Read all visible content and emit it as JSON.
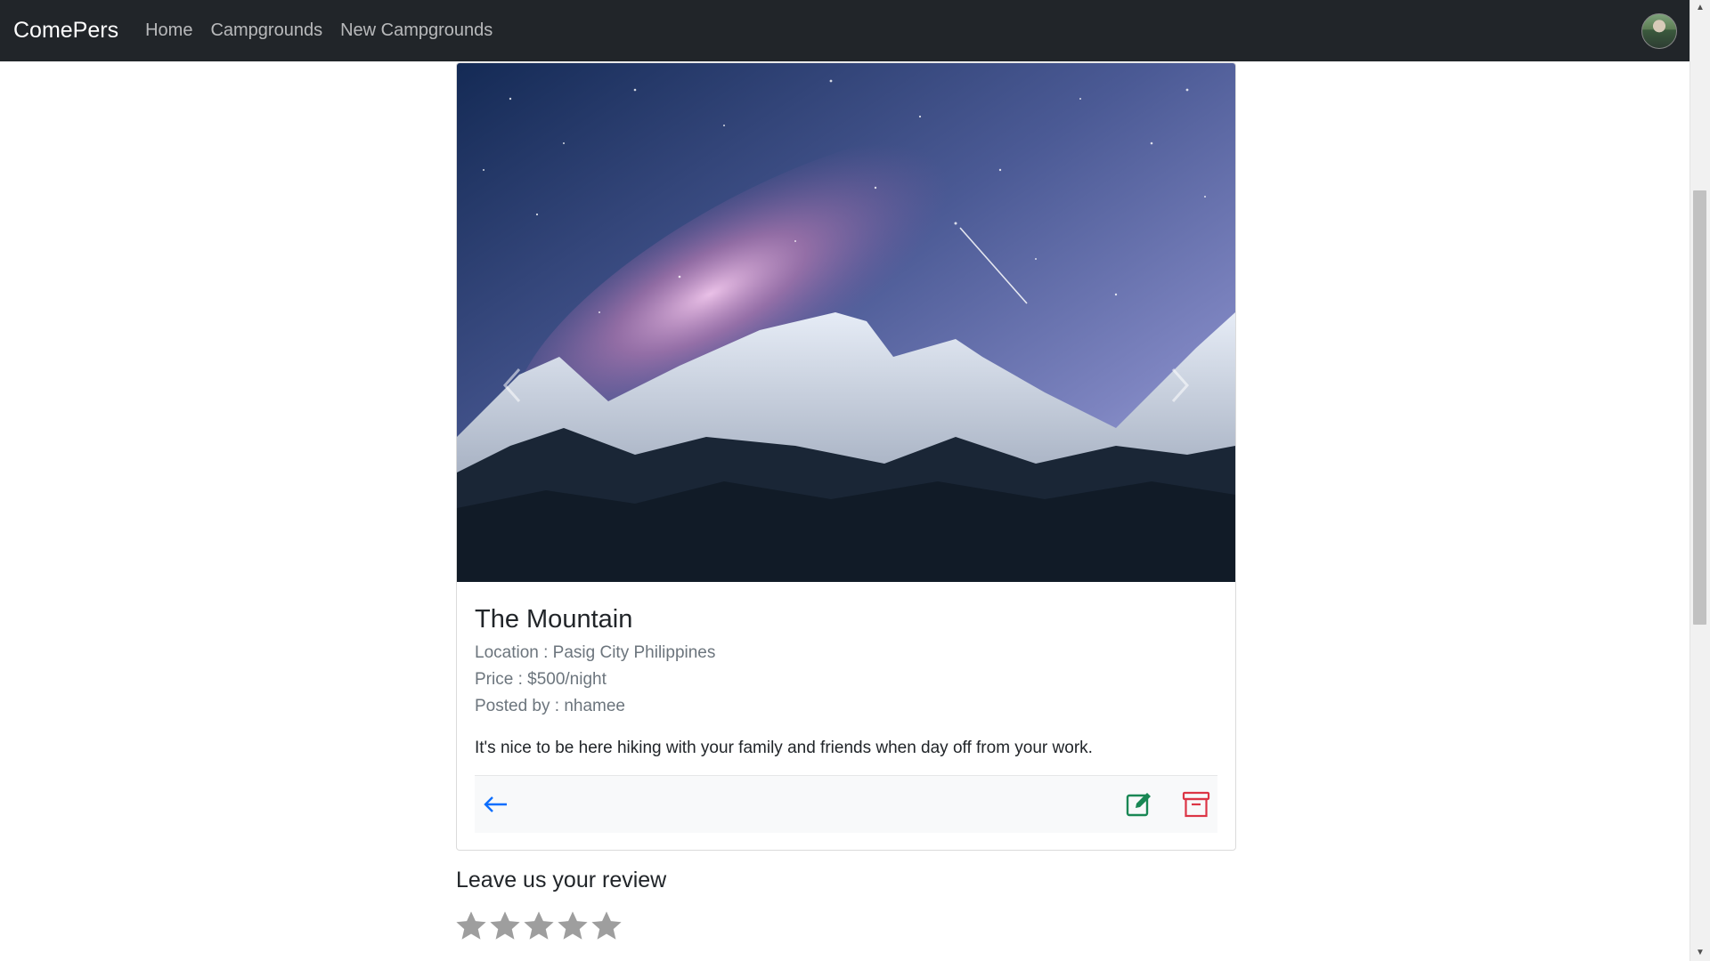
{
  "nav": {
    "brand": "ComePers",
    "links": [
      "Home",
      "Campgrounds",
      "New Campgrounds"
    ]
  },
  "campground": {
    "title": "The Mountain",
    "location": "Location : Pasig City Philippines",
    "price": "Price : $500/night",
    "posted_by": "Posted by : nhamee",
    "description": "It's nice to be here hiking with your family and friends when day off from your work."
  },
  "icons": {
    "back": "arrow-left-icon",
    "edit": "pencil-square-icon",
    "delete": "archive-icon",
    "prev": "chevron-left-icon",
    "next": "chevron-right-icon"
  },
  "review": {
    "heading": "Leave us your review",
    "rating": 0,
    "max_rating": 5
  },
  "colors": {
    "navbar": "#212529",
    "back": "#0d6efd",
    "edit": "#198754",
    "delete": "#dc3545",
    "star_empty": "#9e9e9e"
  }
}
